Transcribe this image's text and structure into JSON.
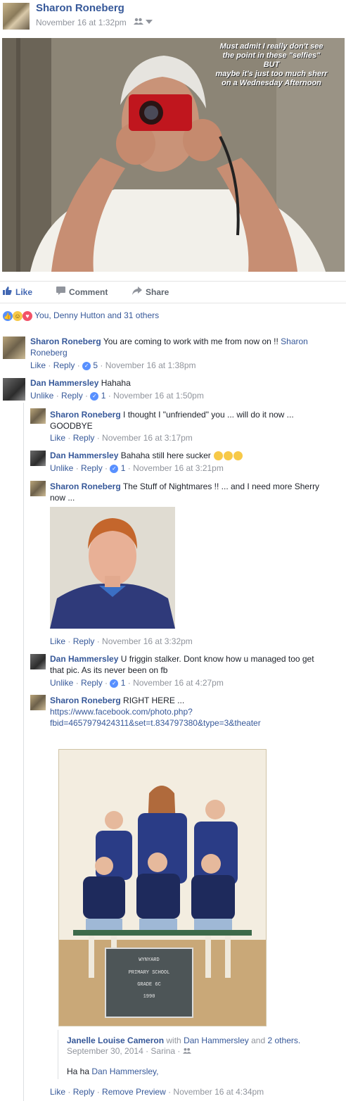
{
  "post": {
    "author": "Sharon Roneberg",
    "time": "November 16 at 1:32pm",
    "audience_icon": "friends-icon",
    "photo_caption": "Must admit I really don't see\nthe point in these \"selfies\"\nBUT\nmaybe it's just too much sherr\non a Wednesday Afternoon"
  },
  "actions": {
    "like": "Like",
    "comment": "Comment",
    "share": "Share"
  },
  "reactions": {
    "summary": "You, Denny Hutton and 31 others"
  },
  "comments": [
    {
      "author": "Sharon Roneberg",
      "text": "You are coming to work with me from now on !! ",
      "mention": "Sharon Roneberg",
      "like": "Like",
      "reply": "Reply",
      "likes": "5",
      "time": "November 16 at 1:38pm"
    },
    {
      "author": "Dan Hammersley",
      "text": "Hahaha",
      "like": "Unlike",
      "reply": "Reply",
      "likes": "1",
      "time": "November 16 at 1:50pm"
    }
  ],
  "replies": [
    {
      "author": "Sharon Roneberg",
      "text": "I thought I \"unfriended\" you ... will do it now ...",
      "text2": "GOODBYE",
      "like": "Like",
      "reply": "Reply",
      "time": "November 16 at 3:17pm"
    },
    {
      "author": "Dan Hammersley",
      "text": "Bahaha still here sucker",
      "like": "Unlike",
      "reply": "Reply",
      "likes": "1",
      "time": "November 16 at 3:21pm"
    },
    {
      "author": "Sharon Roneberg",
      "text": "The Stuff of Nightmares !! ... and I need more Sherry",
      "text2": "now ...",
      "like": "Like",
      "reply": "Reply",
      "time": "November 16 at 3:32pm"
    },
    {
      "author": "Dan Hammersley",
      "text": "U friggin stalker. Dont know how u managed too get",
      "text2": "that pic. As its never been on fb",
      "like": "Unlike",
      "reply": "Reply",
      "likes": "1",
      "time": "November 16 at 4:27pm"
    },
    {
      "author": "Sharon Roneberg",
      "text": "RIGHT HERE ...",
      "url1": "https://www.facebook.com/photo.php?",
      "url2": "fbid=4657979424311&set=t.834797380&type=3&theater",
      "like": "Like",
      "reply": "Reply",
      "remove": "Remove Preview",
      "time": "November 16 at 4:34pm"
    }
  ],
  "preview": {
    "author": "Janelle Louise Cameron",
    "with_word": "with",
    "with_name": "Dan Hammersley",
    "and_word": "and",
    "others": "2 others.",
    "date": "September 30, 2014 · Sarina ·",
    "body_prefix": "Ha ha ",
    "body_link": "Dan Hammersley,",
    "board": [
      "WYNYARD",
      "PRIMARY    SCHOOL",
      "GRADE  6C",
      "1990"
    ]
  },
  "colors": {
    "link": "#365899",
    "meta": "#90949c",
    "like_blue": "#5890ff",
    "haha_yellow": "#f7c948",
    "love_red": "#f25268"
  }
}
